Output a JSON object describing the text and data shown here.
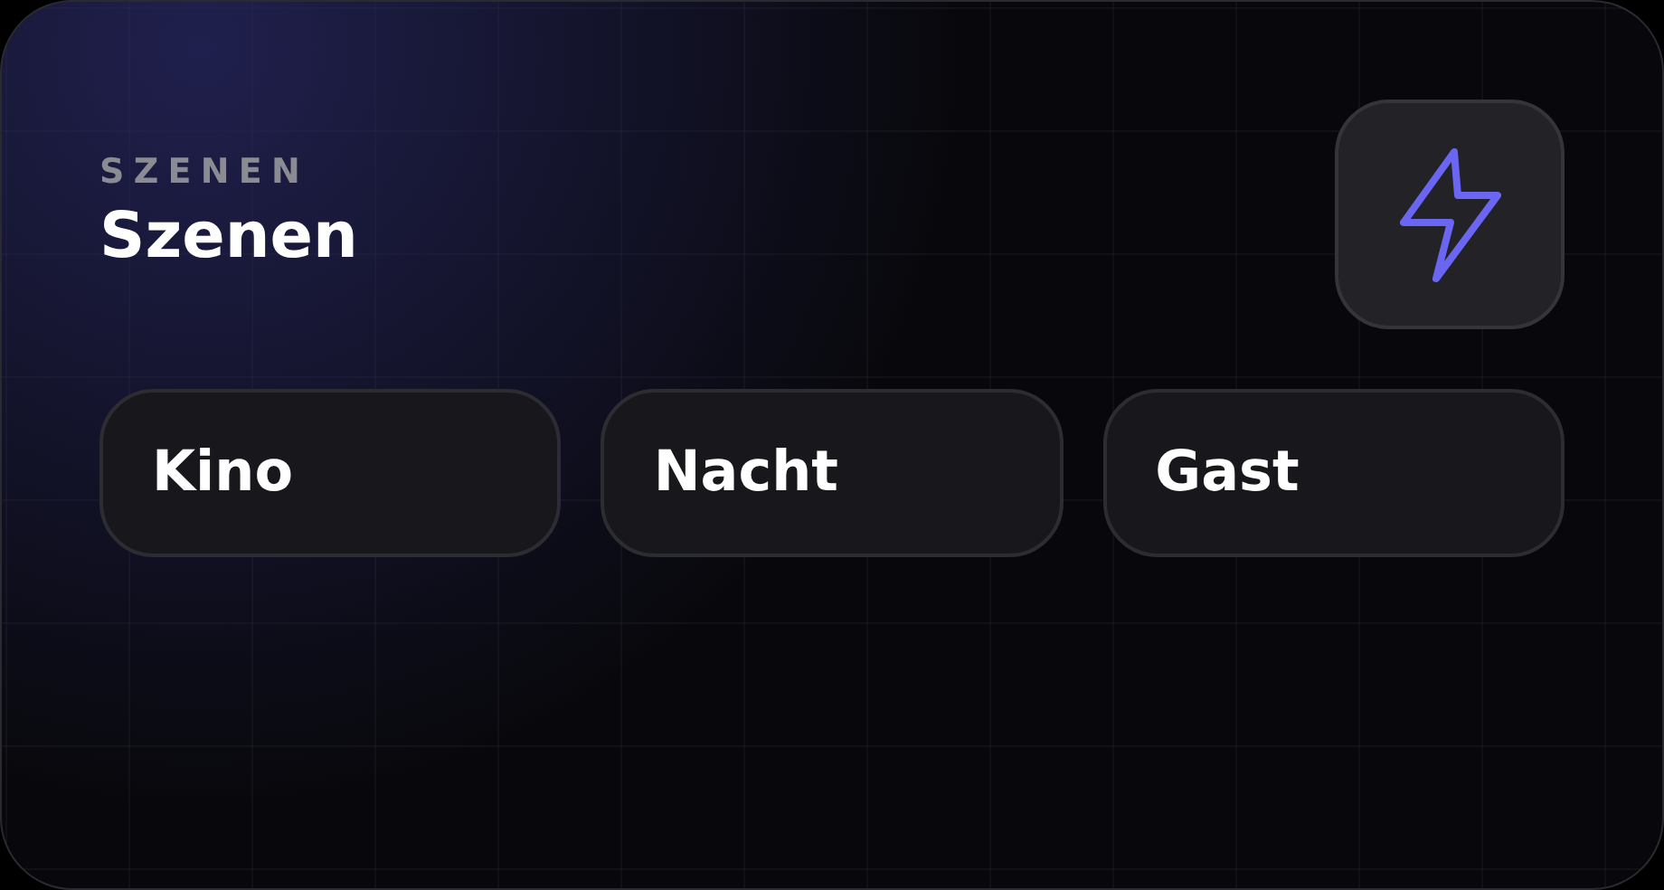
{
  "header": {
    "eyebrow": "SZENEN",
    "title": "Szenen"
  },
  "scenes": [
    {
      "label": "Kino"
    },
    {
      "label": "Nacht"
    },
    {
      "label": "Gast"
    }
  ]
}
